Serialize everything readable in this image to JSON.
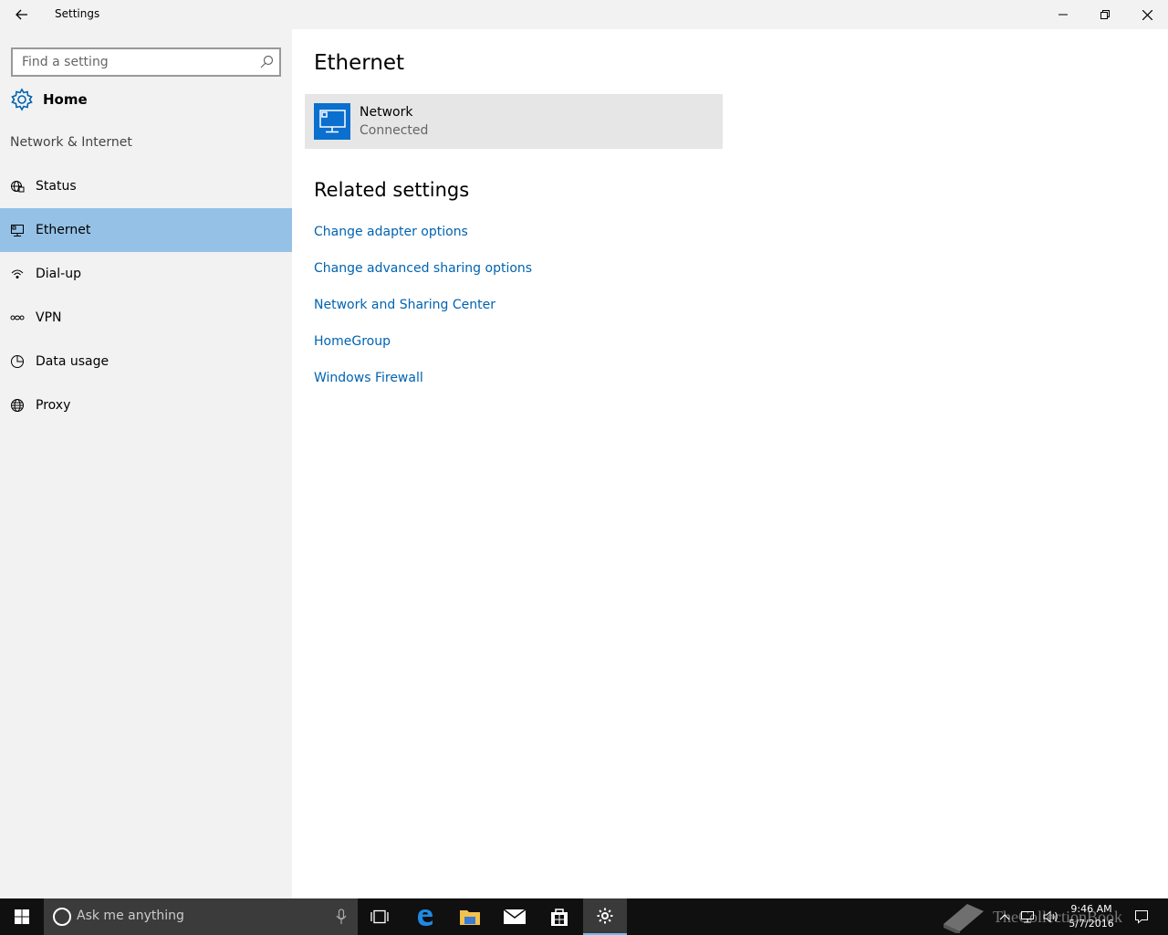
{
  "window": {
    "title": "Settings"
  },
  "sidebar": {
    "search_placeholder": "Find a setting",
    "home_label": "Home",
    "section_label": "Network & Internet",
    "items": [
      {
        "label": "Status",
        "icon": "globe-status-icon",
        "selected": false
      },
      {
        "label": "Ethernet",
        "icon": "ethernet-icon",
        "selected": true
      },
      {
        "label": "Dial-up",
        "icon": "dialup-icon",
        "selected": false
      },
      {
        "label": "VPN",
        "icon": "vpn-icon",
        "selected": false
      },
      {
        "label": "Data usage",
        "icon": "data-usage-icon",
        "selected": false
      },
      {
        "label": "Proxy",
        "icon": "globe-icon",
        "selected": false
      }
    ]
  },
  "main": {
    "title": "Ethernet",
    "network": {
      "name": "Network",
      "status": "Connected"
    },
    "related_title": "Related settings",
    "related_links": [
      "Change adapter options",
      "Change advanced sharing options",
      "Network and Sharing Center",
      "HomeGroup",
      "Windows Firewall"
    ]
  },
  "taskbar": {
    "search_placeholder": "Ask me anything",
    "time": "9:46 AM",
    "date": "5/7/2016",
    "watermark": "TheCollectionBook"
  },
  "colors": {
    "accent": "#0063b1",
    "selected_bg": "#95c1e6",
    "tile_icon_bg": "#0a6fcf"
  }
}
